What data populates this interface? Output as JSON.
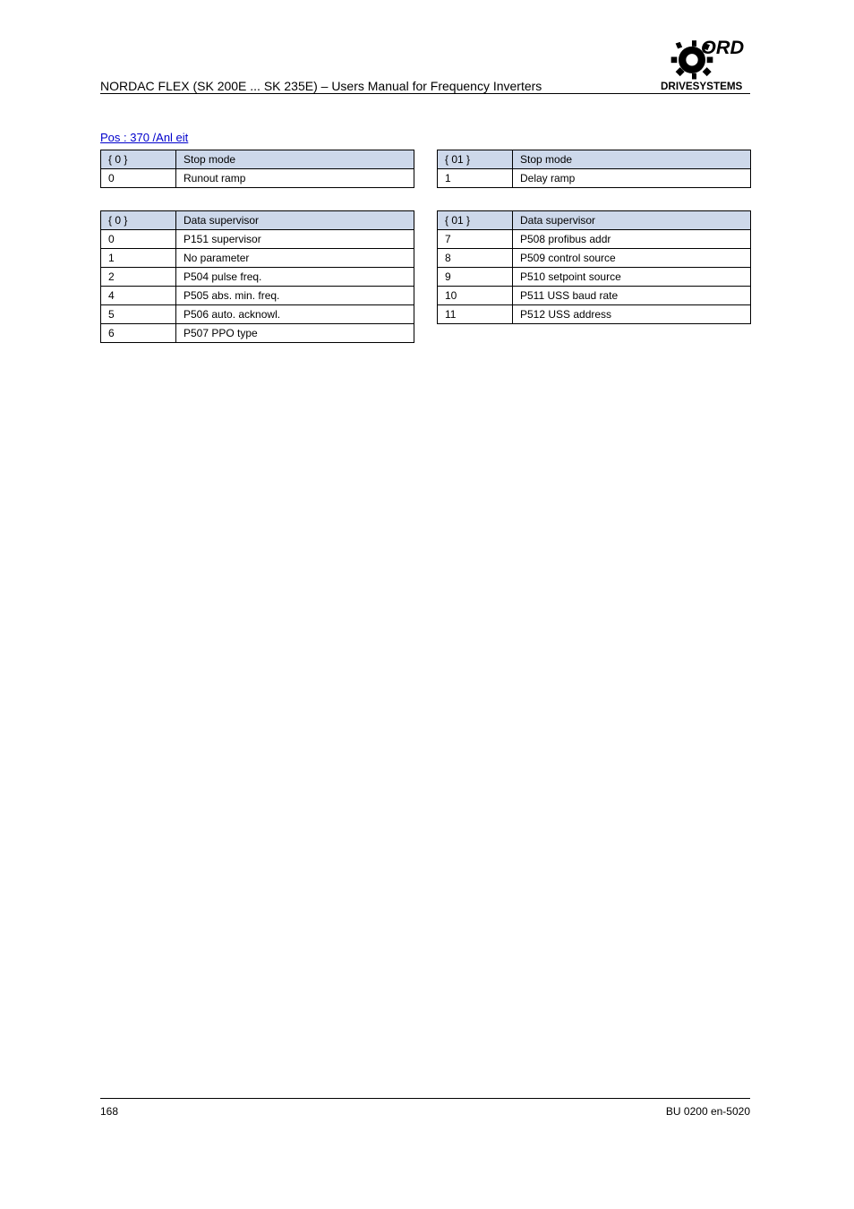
{
  "header": {
    "title": "NORDAC FLEX (SK 200E ... SK 235E) – Users Manual for Frequency Inverters"
  },
  "link_text": "Pos : 370 /Anl eit",
  "tablesA": {
    "left": {
      "headers": [
        "{ 0 }",
        "Stop mode"
      ],
      "rows": [
        [
          "0",
          "Runout ramp"
        ]
      ]
    },
    "right": {
      "headers": [
        "{ 01 }",
        "Stop mode"
      ],
      "rows": [
        [
          "1",
          "Delay ramp"
        ]
      ]
    }
  },
  "tablesB": {
    "left": {
      "headers": [
        "{ 0 }",
        "Data supervisor"
      ],
      "rows": [
        [
          "0",
          "P151 supervisor"
        ],
        [
          "1",
          "No parameter"
        ],
        [
          "2",
          "P504 pulse freq."
        ],
        [
          "4",
          "P505 abs. min. freq."
        ],
        [
          "5",
          "P506 auto. acknowl."
        ],
        [
          "6",
          "P507 PPO type"
        ]
      ]
    },
    "right": {
      "headers": [
        "{ 01 }",
        "Data supervisor"
      ],
      "rows": [
        [
          "7",
          "P508 profibus addr"
        ],
        [
          "8",
          "P509 control source"
        ],
        [
          "9",
          "P510 setpoint source"
        ],
        [
          "10",
          "P511 USS baud rate"
        ],
        [
          "11",
          "P512 USS address"
        ]
      ]
    }
  },
  "footer": {
    "page": "168",
    "docref": "BU 0200 en-5020"
  }
}
